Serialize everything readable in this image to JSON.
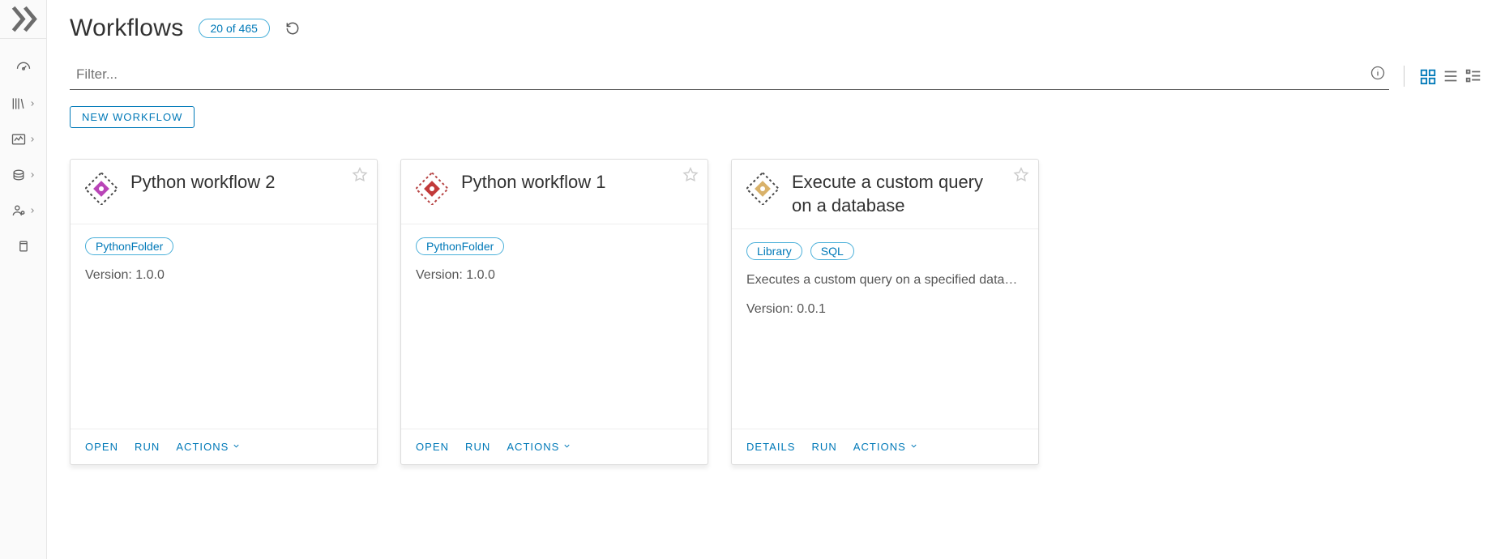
{
  "header": {
    "title": "Workflows",
    "count_label": "20 of 465"
  },
  "filter": {
    "placeholder": "Filter..."
  },
  "new_button_label": "NEW WORKFLOW",
  "cards": [
    {
      "title": "Python workflow 2",
      "tags": [
        "PythonFolder"
      ],
      "description": "",
      "version_label": "Version: 1.0.0",
      "footer": [
        "OPEN",
        "RUN",
        "ACTIONS"
      ],
      "icon_colors": {
        "primary": "#b945b7",
        "secondary": "#4a4a4a"
      }
    },
    {
      "title": "Python workflow 1",
      "tags": [
        "PythonFolder"
      ],
      "description": "",
      "version_label": "Version: 1.0.0",
      "footer": [
        "OPEN",
        "RUN",
        "ACTIONS"
      ],
      "icon_colors": {
        "primary": "#c23a3a",
        "secondary": "#b74545"
      }
    },
    {
      "title": "Execute a custom query on a database",
      "tags": [
        "Library",
        "SQL"
      ],
      "description": "Executes a custom query on a specified database connection…",
      "version_label": "Version: 0.0.1",
      "footer": [
        "DETAILS",
        "RUN",
        "ACTIONS"
      ],
      "icon_colors": {
        "primary": "#d9b26a",
        "secondary": "#4a4a4a"
      }
    }
  ]
}
